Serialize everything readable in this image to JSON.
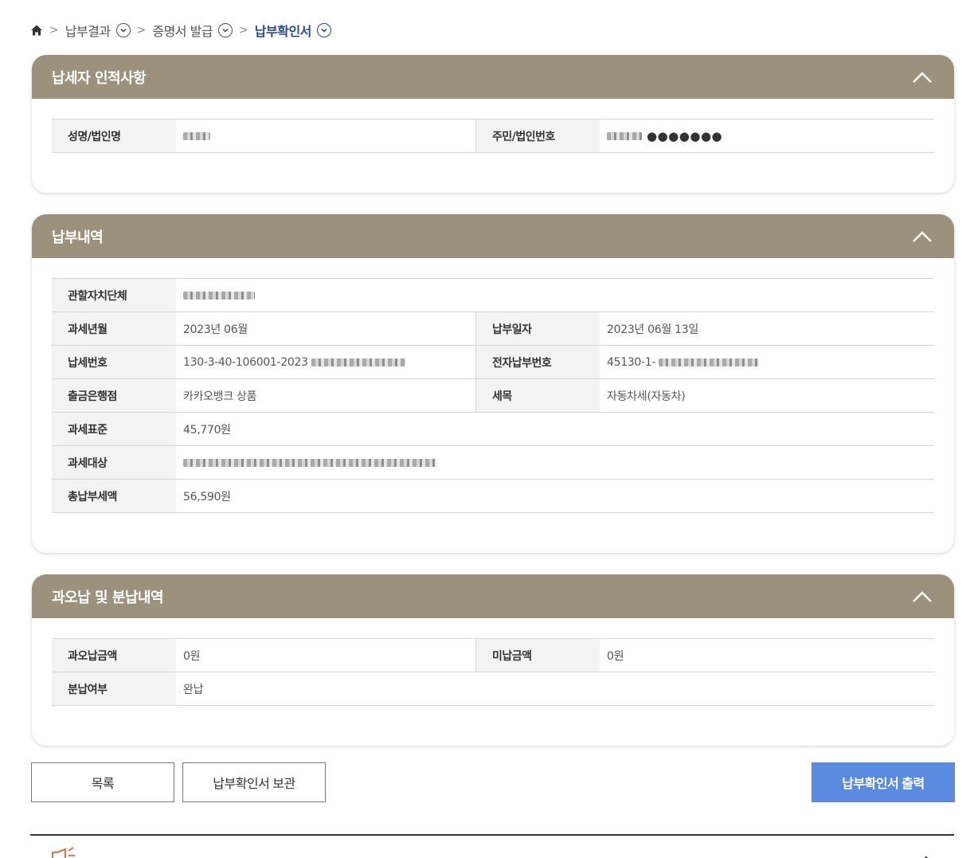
{
  "breadcrumb": {
    "home_icon": "home-icon",
    "items": [
      {
        "label": "납부결과"
      },
      {
        "label": "증명서 발급"
      },
      {
        "label": "납부확인서"
      }
    ]
  },
  "colors": {
    "panel_header": "#9b917d",
    "primary_button": "#5b8be0",
    "current_crumb": "#2b4c8c",
    "footer_accent": "#e0632c"
  },
  "sections": {
    "taxpayer": {
      "title": "납세자 인적사항",
      "rows": {
        "name_label": "성명/법인명",
        "rrn_label": "주민/법인번호",
        "rrn_mask": "●●●●●●●"
      }
    },
    "payment": {
      "title": "납부내역",
      "labels": {
        "authority": "관할자치단체",
        "tax_year_month": "과세년월",
        "payment_date": "납부일자",
        "tax_number": "납세번호",
        "e_payment_number": "전자납부번호",
        "bank": "출금은행점",
        "tax_item": "세목",
        "tax_base": "과세표준",
        "tax_target": "과세대상",
        "total_paid": "총납부세액"
      },
      "values": {
        "tax_year_month": "2023년 06월",
        "payment_date": "2023년 06월 13일",
        "tax_number_prefix": "130-3-40-106001-2023",
        "e_payment_number_prefix": "45130-1-",
        "bank": "카카오뱅크 상품",
        "tax_item": "자동차세(자동차)",
        "tax_base": "45,770원",
        "total_paid": "56,590원"
      }
    },
    "overpay": {
      "title": "과오납 및 분납내역",
      "labels": {
        "overpaid": "과오납금액",
        "unpaid": "미납금액",
        "installment": "분납여부"
      },
      "values": {
        "overpaid": "0원",
        "unpaid": "0원",
        "installment": "완납"
      }
    }
  },
  "buttons": {
    "list": "목록",
    "save": "납부확인서 보관",
    "print": "납부확인서 출력"
  },
  "footer": {
    "info_icon": "megaphone-icon",
    "chevron_icon": "chevron-up-icon"
  }
}
